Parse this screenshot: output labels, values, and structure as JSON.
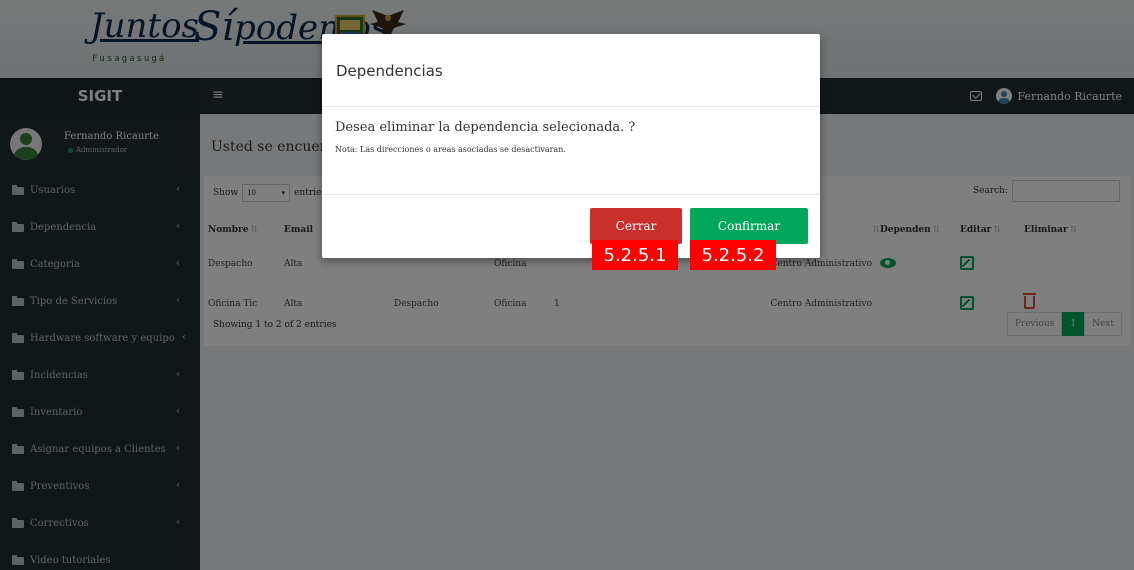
{
  "banner": {
    "logo_word1": "Juntos",
    "logo_si": "Sí",
    "logo_word2": "podemos",
    "logo_city": "Fusagasugá"
  },
  "topbar": {
    "brand": "SIGIT",
    "menu_icon": "hamburger-icon",
    "user_name": "Fernando Ricaurte"
  },
  "sidebar": {
    "user_name": "Fernando Ricaurte",
    "user_role": "Administrador",
    "items": [
      {
        "label": "Usuarios"
      },
      {
        "label": "Dependencia"
      },
      {
        "label": "Categoria"
      },
      {
        "label": "Tipo de Servicios"
      },
      {
        "label": "Hardware software y equipo"
      },
      {
        "label": "Incidencias"
      },
      {
        "label": "Inventario"
      },
      {
        "label": "Asignar equipos a Clientes"
      },
      {
        "label": "Preventivos"
      },
      {
        "label": "Correctivos"
      },
      {
        "label": "Video tutoriales"
      }
    ]
  },
  "main": {
    "header": "Usted se encuentra",
    "show_label": "Show",
    "show_value": "10",
    "entries_label": "entries",
    "search_label": "Search:",
    "columns": [
      "Nombre",
      "Email",
      "",
      "",
      "",
      "",
      "",
      "Dependen",
      "Editar",
      "Eliminar"
    ],
    "rows": [
      {
        "nombre": "Despacho",
        "c2": "Alta",
        "c3": "",
        "c4": "Oficina",
        "c5": "",
        "c6": "Centro Administrativo"
      },
      {
        "nombre": "Oficina Tic",
        "c2": "Alta",
        "c3": "Despacho",
        "c4": "Oficina",
        "c5": "1",
        "c6": "Centro Administrativo"
      }
    ],
    "info": "Showing 1 to 2 of 2 entries",
    "pager": {
      "previous": "Previous",
      "page": "1",
      "next": "Next"
    }
  },
  "modal": {
    "title": "Dependencias",
    "message": "Desea eliminar la dependencia selecionada. ?",
    "note": "Nota: Las direcciones o areas asociadas se desactivaran.",
    "close_label": "Cerrar",
    "confirm_label": "Confirmar"
  },
  "annotations": {
    "tag1": "5.2.5.1",
    "tag2": "5.2.5.2"
  },
  "colors": {
    "sidebar": "#222d32",
    "close_button": "#c9302c",
    "confirm_button": "#00a65a",
    "annotation": "#ff0000"
  }
}
